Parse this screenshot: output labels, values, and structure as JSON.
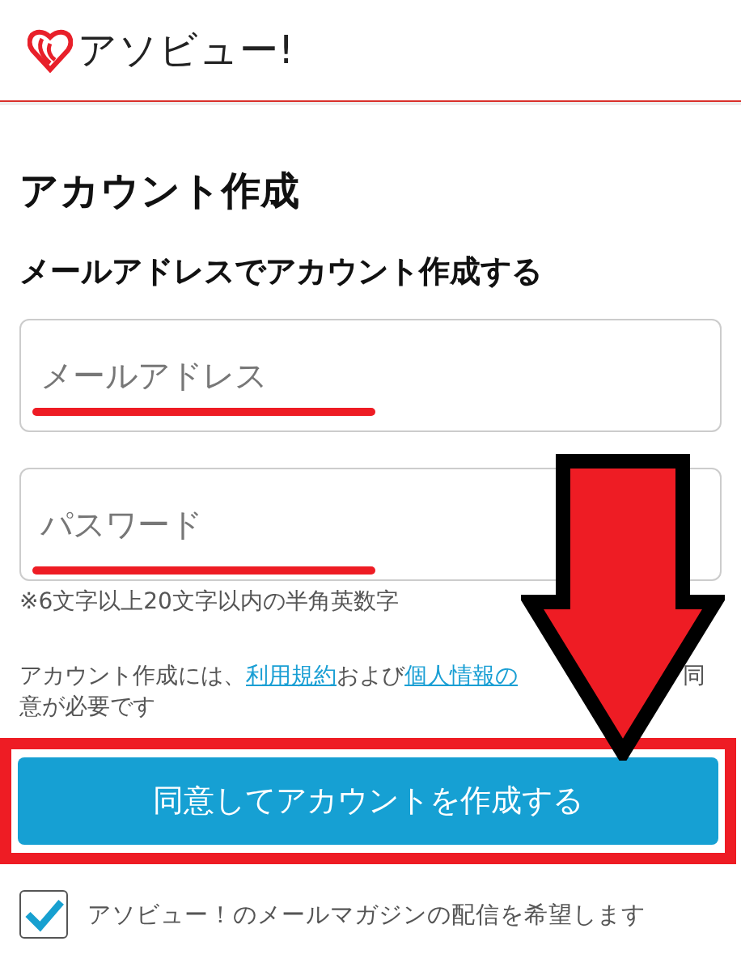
{
  "header": {
    "logo_text": "アソビュー!"
  },
  "title": "アカウント作成",
  "subtitle": "メールアドレスでアカウント作成する",
  "fields": [
    {
      "placeholder": "メールアドレス"
    },
    {
      "placeholder": "パスワード"
    }
  ],
  "password_note": "※6文字以上20文字以内の半角英数字",
  "consent": {
    "before": "アカウント作成には、",
    "link_1": "利用規約",
    "middle": "および",
    "link_2": "個人情報の",
    "after": "同意が必要です"
  },
  "submit_button": "同意してアカウントを作成する",
  "newsletter": {
    "label": "アソビュー！のメールマガジンの配信を希望します",
    "checked": true
  }
}
